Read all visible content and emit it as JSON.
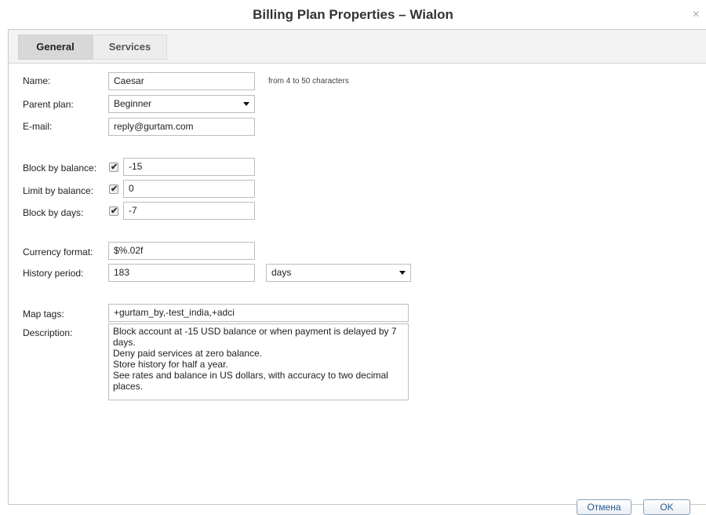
{
  "window": {
    "title": "Billing Plan Properties – Wialon",
    "close_glyph": "×"
  },
  "tabs": [
    {
      "label": "General",
      "active": true
    },
    {
      "label": "Services",
      "active": false
    }
  ],
  "form": {
    "name": {
      "label": "Name:",
      "value": "Caesar",
      "hint": "from 4 to 50 characters"
    },
    "parent_plan": {
      "label": "Parent plan:",
      "value": "Beginner"
    },
    "email": {
      "label": "E-mail:",
      "value": "reply@gurtam.com"
    },
    "block_by_balance": {
      "label": "Block by balance:",
      "checked": true,
      "value": "-15"
    },
    "limit_by_balance": {
      "label": "Limit by balance:",
      "checked": true,
      "value": "0"
    },
    "block_by_days": {
      "label": "Block by days:",
      "checked": true,
      "value": "-7"
    },
    "currency_format": {
      "label": "Currency format:",
      "value": "$%.02f"
    },
    "history_period": {
      "label": "History period:",
      "value": "183",
      "unit": "days"
    },
    "map_tags": {
      "label": "Map tags:",
      "value": "+gurtam_by,-test_india,+adci"
    },
    "description": {
      "label": "Description:",
      "value": "Block account at -15 USD balance or when payment is delayed by 7 days.\nDeny paid services at zero balance.\nStore history for half a year.\nSee rates and balance in US dollars, with accuracy to two decimal places."
    }
  },
  "buttons": {
    "cancel": "Отмена",
    "ok": "OK"
  }
}
